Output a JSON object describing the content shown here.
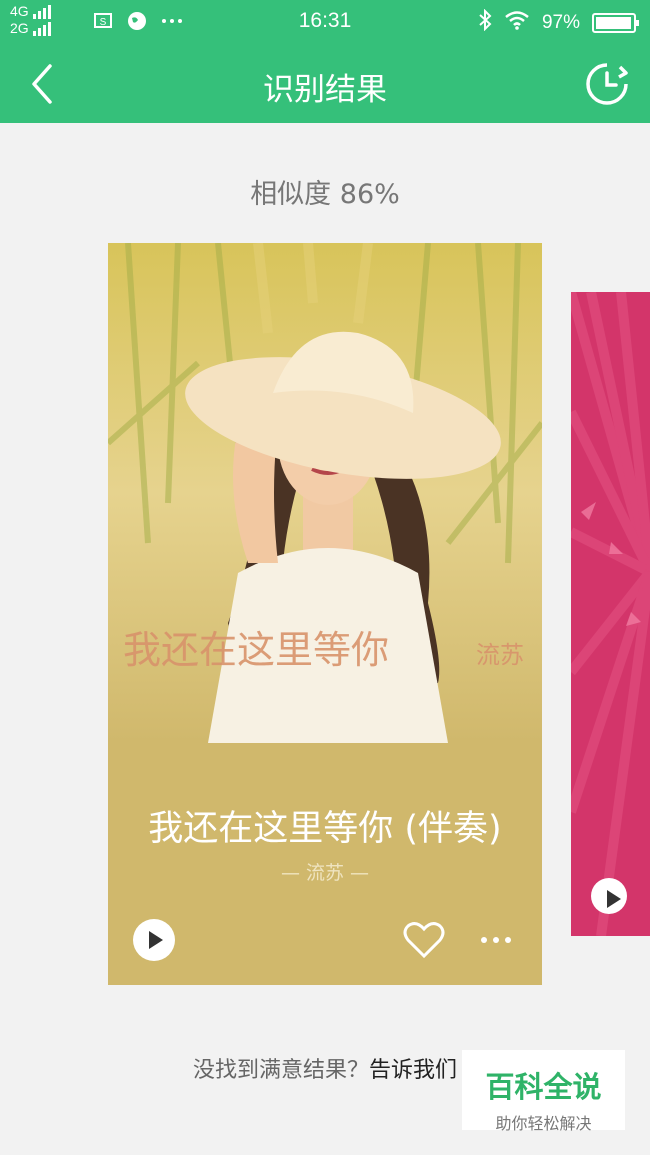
{
  "status_bar": {
    "network_top": "4G",
    "network_bottom": "2G",
    "time": "16:31",
    "battery": "97%"
  },
  "navbar": {
    "title": "识别结果"
  },
  "similarity": "相似度 86%",
  "result_card": {
    "cover_text": "我还在这里等你",
    "cover_artist": "流苏",
    "title": "我还在这里等你 (伴奏)",
    "artist": "— 流苏 —"
  },
  "footer": {
    "prompt": "没找到满意结果？",
    "link": "告诉我们"
  },
  "watermark": {
    "title": "百科全说",
    "subtitle": "助你轻松解决"
  },
  "colors": {
    "primary_green": "#35c07a",
    "card_gold": "#d0b86c",
    "card_pink": "#d3356a"
  }
}
